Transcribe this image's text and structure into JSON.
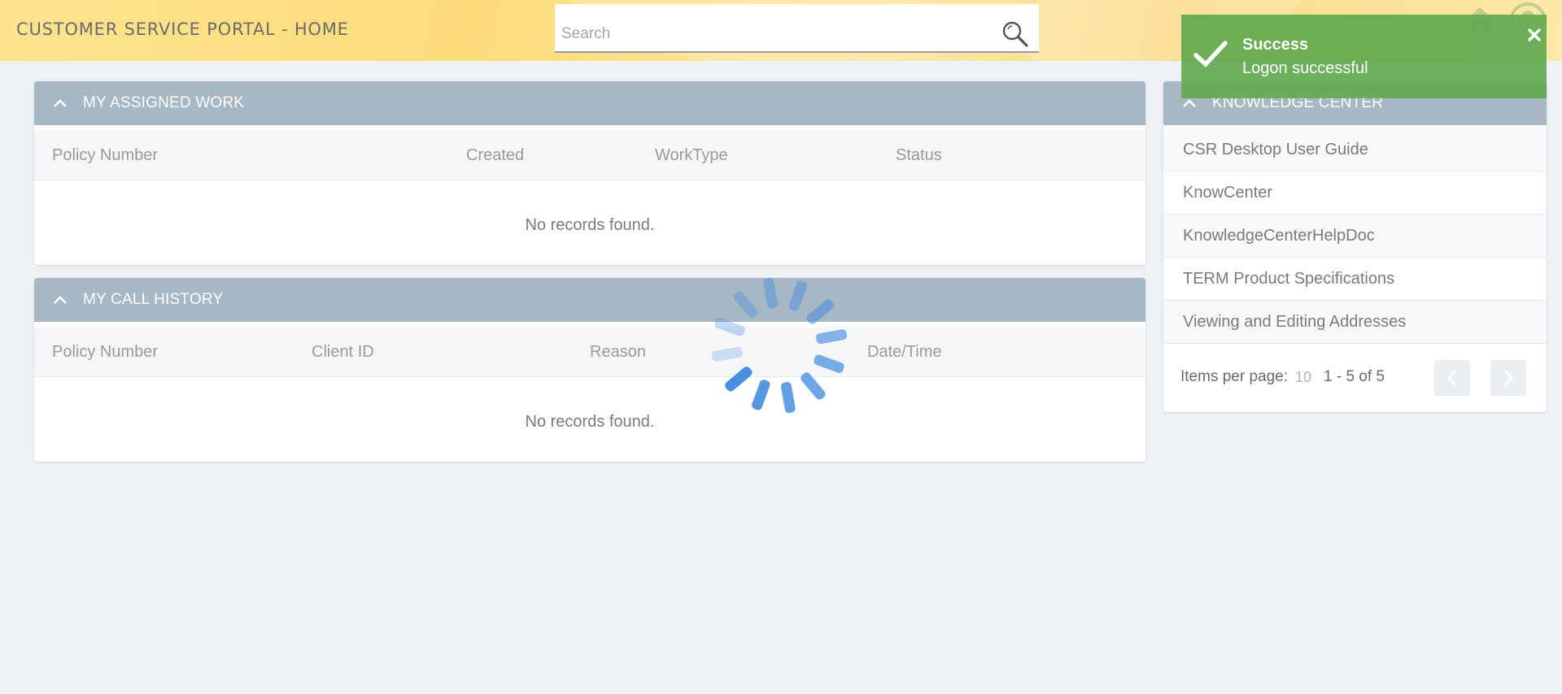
{
  "header": {
    "title": "CUSTOMER SERVICE PORTAL - HOME",
    "search": {
      "placeholder": "Search",
      "value": ""
    },
    "icons": [
      "search-icon",
      "home-icon",
      "user-icon"
    ]
  },
  "assigned_work": {
    "title": "MY ASSIGNED WORK",
    "columns": [
      "Policy Number",
      "Created",
      "WorkType",
      "Status"
    ],
    "rows": [],
    "empty_message": "No records found."
  },
  "call_history": {
    "title": "MY CALL HISTORY",
    "columns": [
      "Policy Number",
      "Client ID",
      "Reason",
      "Date/Time"
    ],
    "rows": [],
    "empty_message": "No records found."
  },
  "knowledge_center": {
    "title": "KNOWLEDGE CENTER",
    "items": [
      "CSR Desktop User Guide",
      "KnowCenter",
      "KnowledgeCenterHelpDoc",
      "TERM Product Specifications",
      "Viewing and Editing Addresses"
    ],
    "items_per_page_label": "Items per page:",
    "items_per_page_value": "10",
    "range_text": "1 - 5 of 5"
  },
  "toast": {
    "title": "Success",
    "message": "Logon successful"
  },
  "colors": {
    "header_accent": "#fddc7c",
    "panel_header": "#a7b7c3",
    "toast_success": "#62aa50",
    "spinner": "#4a8fdf"
  }
}
